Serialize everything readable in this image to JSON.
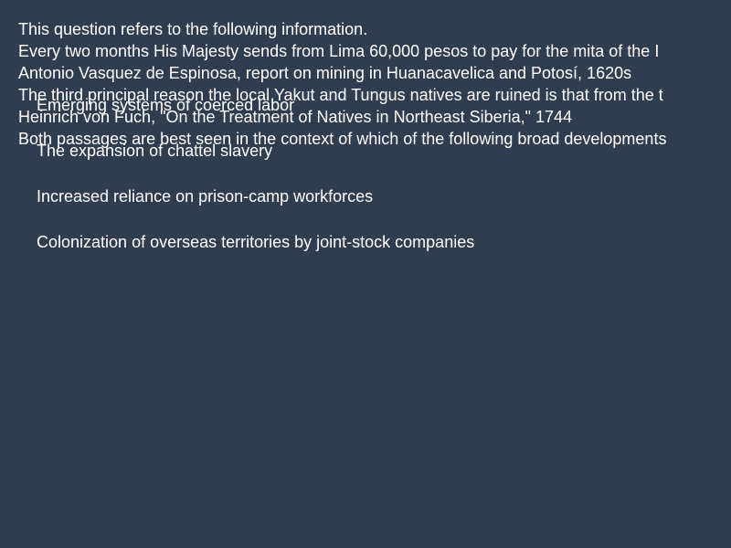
{
  "question": {
    "intro": "This question refers to the following information.",
    "passage1_text": "Every two months His Majesty sends from Lima 60,000 pesos to pay for the mita of the I",
    "passage1_source": "Antonio Vasquez de Espinosa, report on mining in Huanacavelica and Potosí, 1620s",
    "passage2_text": "The third principal reason the local Yakut and Tungus natives are ruined is that from the t",
    "passage2_source": "Heinrich von Fuch, \"On the Treatment of Natives in Northeast Siberia,\" 1744",
    "prompt": "Both passages are best seen in the context of which of the following broad developments"
  },
  "options": [
    "Emerging systems of coerced labor",
    "The expansion of chattel slavery",
    "Increased reliance on prison-camp workforces",
    "Colonization of overseas territories by joint-stock companies"
  ]
}
